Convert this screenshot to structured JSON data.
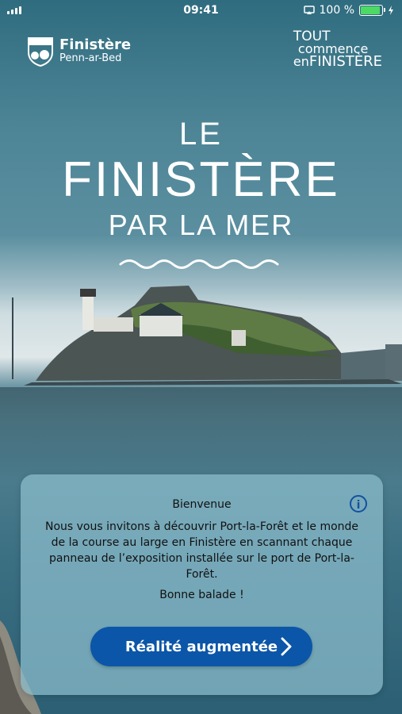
{
  "status": {
    "time": "09:41",
    "battery": "100 %"
  },
  "logos": {
    "left_name": "Finistère",
    "left_sub": "Penn-ar-Bed",
    "right_l1": "TOUT",
    "right_l2": "commence",
    "right_l3a": "en",
    "right_l3b": "FINISTÈRE"
  },
  "hero": {
    "line1": "LE",
    "line2": "FINISTÈRE",
    "line3": "PAR LA MER"
  },
  "card": {
    "title": "Bienvenue",
    "body": "Nous vous invitons à découvrir Port-la-Forêt et le monde de la course au large en Finistère en scannant chaque panneau de l’exposition installée sur le port de Port-la-Forêt.",
    "farewell": "Bonne balade !",
    "button_label": "Réalité augmentée"
  }
}
